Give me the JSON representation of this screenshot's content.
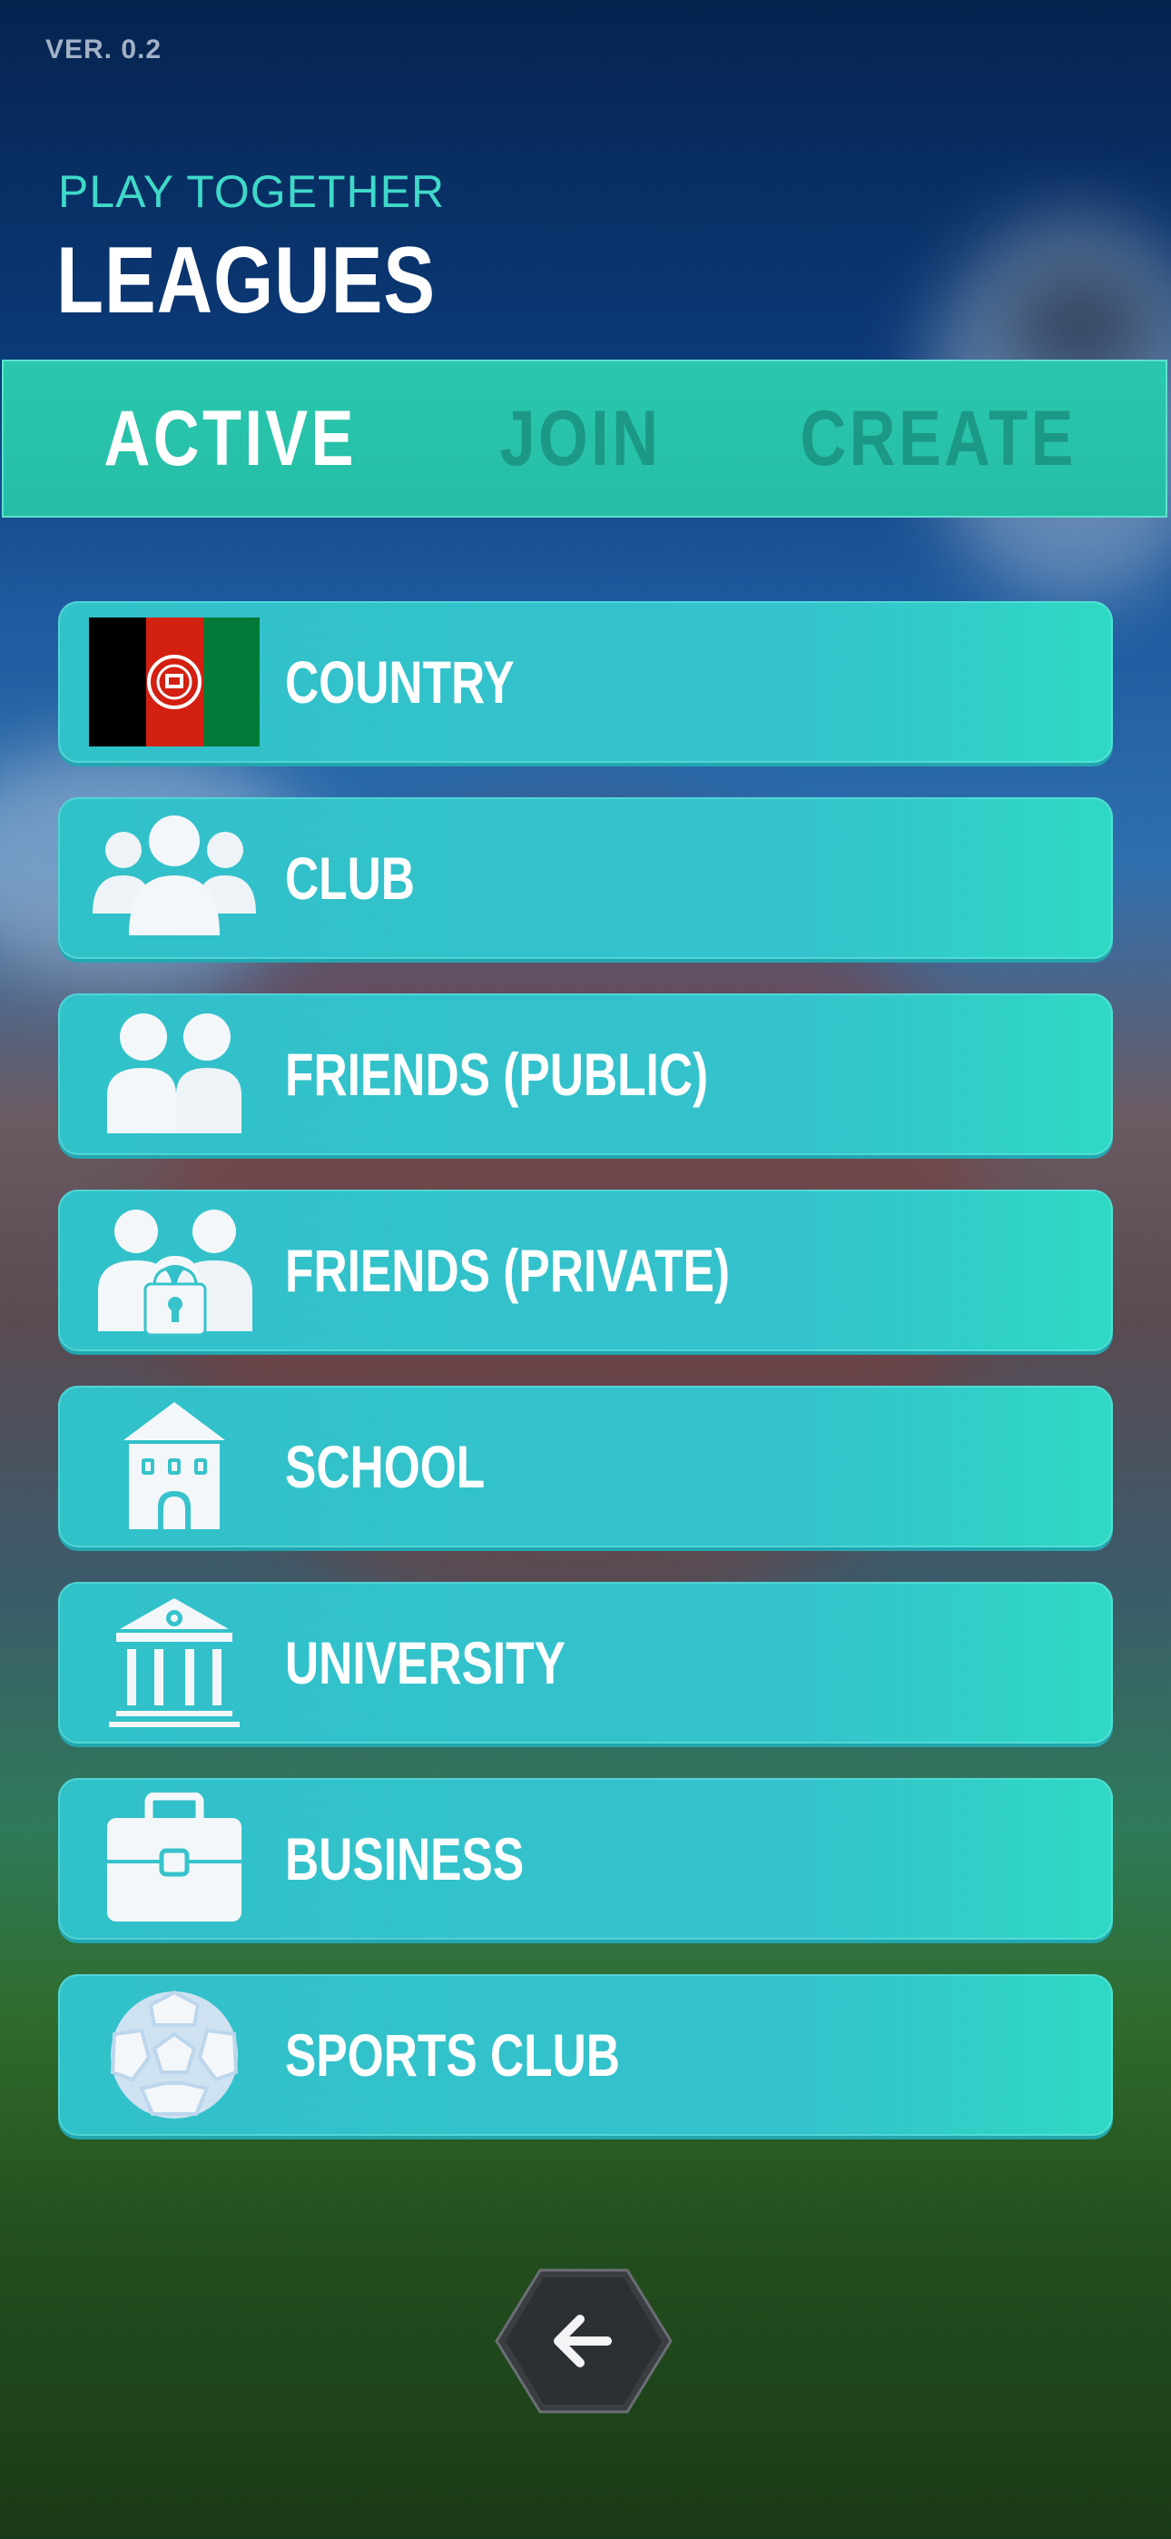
{
  "version": "VER. 0.2",
  "header": {
    "subtitle": "PLAY TOGETHER",
    "title": "LEAGUES"
  },
  "tabs": [
    {
      "label": "ACTIVE",
      "active": true
    },
    {
      "label": "JOIN",
      "active": false
    },
    {
      "label": "CREATE",
      "active": false
    }
  ],
  "leagues": [
    {
      "label": "COUNTRY",
      "icon": "afghanistan-flag-icon"
    },
    {
      "label": "CLUB",
      "icon": "group-icon"
    },
    {
      "label": "FRIENDS (PUBLIC)",
      "icon": "two-people-icon"
    },
    {
      "label": "FRIENDS (PRIVATE)",
      "icon": "two-people-lock-icon"
    },
    {
      "label": "SCHOOL",
      "icon": "school-building-icon"
    },
    {
      "label": "UNIVERSITY",
      "icon": "university-building-icon"
    },
    {
      "label": "BUSINESS",
      "icon": "briefcase-icon"
    },
    {
      "label": "SPORTS CLUB",
      "icon": "soccer-ball-icon"
    }
  ],
  "back_button": {
    "icon": "arrow-left-icon"
  },
  "colors": {
    "accent": "#2ac7ae",
    "row": "#34c2cc",
    "subtitle": "#3fd9c9",
    "inactive_tab": "#1c9886"
  }
}
